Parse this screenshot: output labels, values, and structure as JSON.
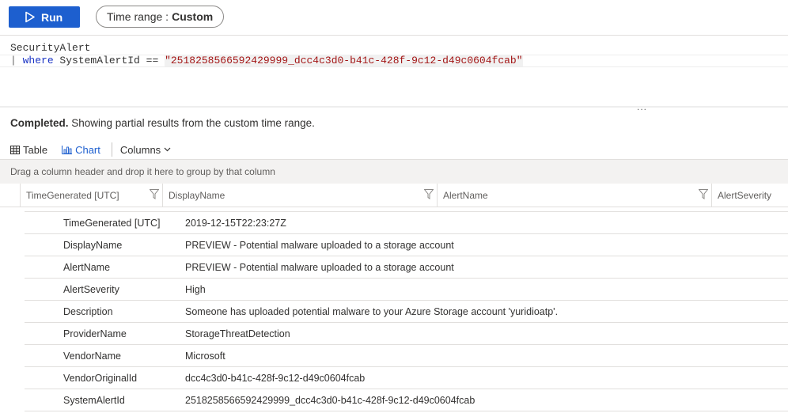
{
  "toolbar": {
    "run_label": "Run",
    "time_range_label": "Time range :",
    "time_range_value": "Custom"
  },
  "editor": {
    "line1": "SecurityAlert",
    "line2_pipe": "| ",
    "line2_keyword": "where",
    "line2_field": " SystemAlertId == ",
    "line2_string": "\"2518258566592429999_dcc4c3d0-b41c-428f-9c12-d49c0604fcab\"",
    "more": "..."
  },
  "status": {
    "bold": "Completed.",
    "text": " Showing partial results from the custom time range."
  },
  "tabs": {
    "table": "Table",
    "chart": "Chart",
    "columns": "Columns"
  },
  "group_hint": "Drag a column header and drop it here to group by that column",
  "columns": [
    "TimeGenerated [UTC]",
    "DisplayName",
    "AlertName",
    "AlertSeverity"
  ],
  "details": [
    {
      "key": "TimeGenerated [UTC]",
      "value": "2019-12-15T22:23:27Z"
    },
    {
      "key": "DisplayName",
      "value": "PREVIEW - Potential malware uploaded to a storage account"
    },
    {
      "key": "AlertName",
      "value": "PREVIEW - Potential malware uploaded to a storage account"
    },
    {
      "key": "AlertSeverity",
      "value": "High"
    },
    {
      "key": "Description",
      "value": "Someone has uploaded potential malware to your Azure Storage account 'yuridioatp'."
    },
    {
      "key": "ProviderName",
      "value": "StorageThreatDetection"
    },
    {
      "key": "VendorName",
      "value": "Microsoft"
    },
    {
      "key": "VendorOriginalId",
      "value": "dcc4c3d0-b41c-428f-9c12-d49c0604fcab"
    },
    {
      "key": "SystemAlertId",
      "value": "2518258566592429999_dcc4c3d0-b41c-428f-9c12-d49c0604fcab"
    }
  ],
  "colors": {
    "run_button": "#1d5fcf",
    "keyword": "#1a33c4",
    "string": "#a31515",
    "link": "#1d5fcf"
  }
}
